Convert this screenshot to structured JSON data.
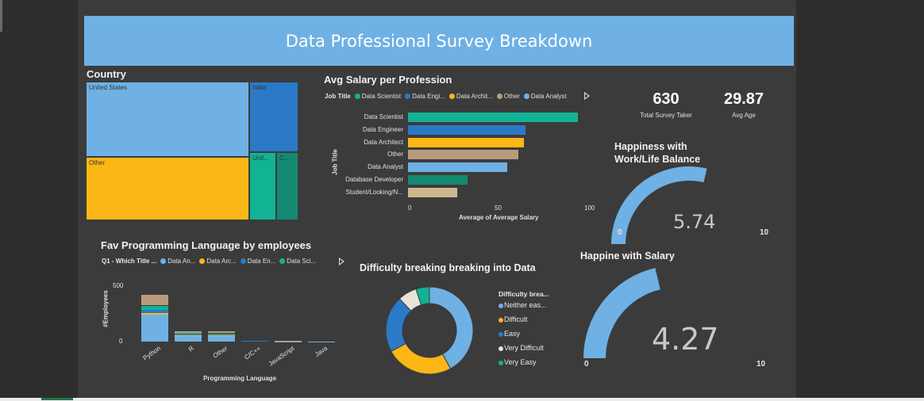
{
  "title": "Data Professional Survey Breakdown",
  "country": {
    "title": "Country",
    "cells": [
      {
        "label": "United States",
        "color": "#6fb1e4"
      },
      {
        "label": "India",
        "color": "#2a7ac7"
      },
      {
        "label": "Other",
        "color": "#fbb716"
      },
      {
        "label": "Unit...",
        "color": "#12b394"
      },
      {
        "label": "C...",
        "color": "#148a72"
      }
    ]
  },
  "kpis": {
    "survey_takers": {
      "value": "630",
      "label": "Total Survey Taker"
    },
    "avg_age": {
      "value": "29.87",
      "label": "Avg Age"
    }
  },
  "chart_data": [
    {
      "id": "salary",
      "type": "bar",
      "orientation": "horizontal",
      "title": "Avg Salary per Profession",
      "legend_title": "Job Title",
      "legend": [
        {
          "name": "Data Scientist",
          "color": "#12b394"
        },
        {
          "name": "Data Engi...",
          "color": "#2a7ac7"
        },
        {
          "name": "Data Archit...",
          "color": "#fbb716"
        },
        {
          "name": "Other",
          "color": "#b99b7b"
        },
        {
          "name": "Data Analyst",
          "color": "#6fb1e4"
        }
      ],
      "categories": [
        "Data Scientist",
        "Data Engineer",
        "Data Architect",
        "Other",
        "Data Analyst",
        "Database Developer",
        "Student/Looking/N..."
      ],
      "values": [
        94,
        65,
        64,
        61,
        55,
        33,
        27
      ],
      "colors": [
        "#12b394",
        "#2a7ac7",
        "#fbb716",
        "#b99b7b",
        "#6fb1e4",
        "#148a72",
        "#cbb88f"
      ],
      "xlabel": "Average of Average Salary",
      "ylabel": "Job Title",
      "xlim": [
        0,
        100
      ],
      "xticks": [
        "0",
        "50",
        "100"
      ]
    },
    {
      "id": "languages",
      "type": "bar",
      "stacked": true,
      "title": "Fav Programming Language by employees",
      "legend_title": "Q1 - Which Title ...",
      "legend": [
        {
          "name": "Data An...",
          "color": "#6fb1e4"
        },
        {
          "name": "Data Arc...",
          "color": "#fbb716"
        },
        {
          "name": "Data En...",
          "color": "#2a7ac7"
        },
        {
          "name": "Data Sci...",
          "color": "#12b394"
        }
      ],
      "categories": [
        "Python",
        "R",
        "Other",
        "C/C++",
        "JavaScript",
        "Java"
      ],
      "series": [
        {
          "values": [
            245,
            55,
            55,
            4,
            3,
            2
          ],
          "color": "#6fb1e4"
        },
        {
          "values": [
            12,
            5,
            4,
            0,
            0,
            0
          ],
          "color": "#fbb716"
        },
        {
          "values": [
            30,
            8,
            8,
            1,
            1,
            0
          ],
          "color": "#2a7ac7"
        },
        {
          "values": [
            38,
            10,
            8,
            0,
            0,
            0
          ],
          "color": "#12b394"
        },
        {
          "values": [
            95,
            12,
            20,
            0,
            1,
            0
          ],
          "color": "#b99b7b"
        }
      ],
      "xlabel": "Programming Language",
      "ylabel": "#Employees",
      "ylim": [
        0,
        500
      ],
      "yticks": [
        "0",
        "500"
      ]
    },
    {
      "id": "difficulty",
      "type": "pie",
      "donut": true,
      "title": "Difficulty breaking breaking into Data",
      "legend_title": "Difficulty brea...",
      "slices": [
        {
          "label": "Neither eas...",
          "value": 42,
          "color": "#6fb1e4"
        },
        {
          "label": "Difficult",
          "value": 25,
          "color": "#fbb716"
        },
        {
          "label": "Easy",
          "value": 21,
          "color": "#2a7ac7"
        },
        {
          "label": "Very Difficult",
          "value": 7,
          "color": "#e8e3d6"
        },
        {
          "label": "Very Easy",
          "value": 5,
          "color": "#12b394"
        }
      ]
    },
    {
      "id": "gauge_work",
      "type": "gauge",
      "title": "Happiness with Work/Life Balance",
      "value": 5.74,
      "display": "5.74",
      "min": 0,
      "max": 10,
      "min_label": "0",
      "max_label": "10",
      "color": "#6fb1e4"
    },
    {
      "id": "gauge_salary",
      "type": "gauge",
      "title": "Happine with Salary",
      "value": 4.27,
      "display": "4.27",
      "min": 0,
      "max": 10,
      "min_label": "0",
      "max_label": "10",
      "color": "#6fb1e4"
    }
  ]
}
